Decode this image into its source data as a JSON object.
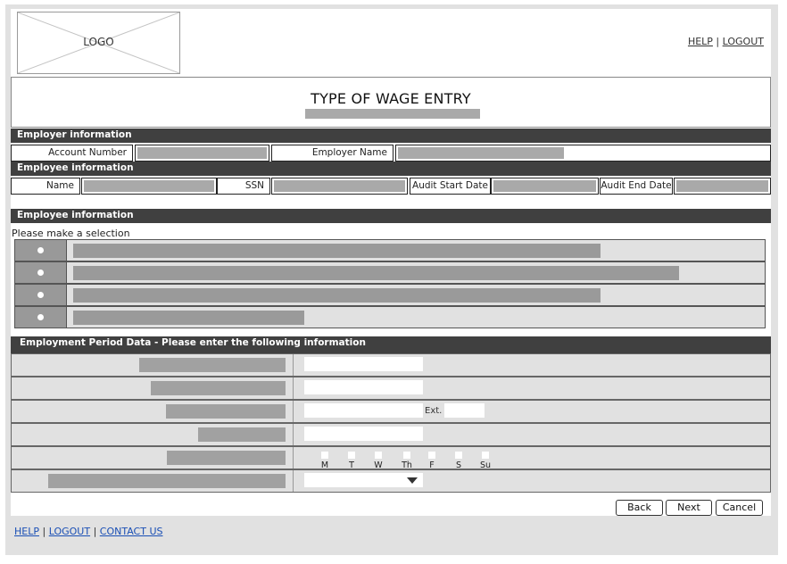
{
  "header": {
    "logo_text": "LOGO",
    "help_link": "HELP",
    "separator": "|",
    "logout_link": "LOGOUT"
  },
  "title": {
    "text": "TYPE OF WAGE ENTRY"
  },
  "employer_section": {
    "heading": "Employer information",
    "account_number_label": "Account Number",
    "employer_name_label": "Employer Name"
  },
  "employee_section": {
    "heading": "Employee information",
    "name_label": "Name",
    "ssn_label": "SSN",
    "audit_start_label": "Audit Start Date",
    "audit_end_label": "Audit End Date"
  },
  "selection_section": {
    "heading": "Employee information",
    "prompt": "Please make a selection",
    "option_count": 4
  },
  "period_section": {
    "heading": "Employment Period Data - Please enter the following information",
    "ext_label": "Ext.",
    "days": [
      "M",
      "T",
      "W",
      "Th",
      "F",
      "S",
      "Su"
    ]
  },
  "buttons": {
    "back": "Back",
    "next": "Next",
    "cancel": "Cancel"
  },
  "footer": {
    "help_link": "HELP",
    "logout_link": "LOGOUT",
    "contact_link": "CONTACT US",
    "separator": "|"
  },
  "colors": {
    "section_bar": "#404040",
    "placeholder_bar": "#a9a9a9",
    "row_background": "#e1e1e1",
    "footer_link": "#1a4fb5"
  }
}
